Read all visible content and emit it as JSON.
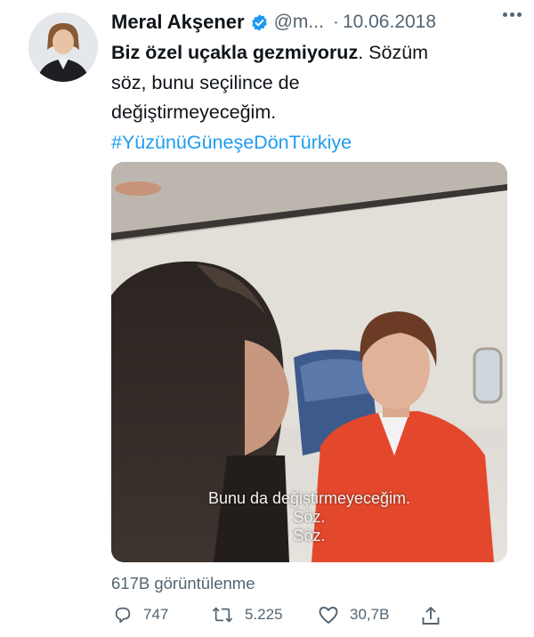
{
  "tweet": {
    "author_name": "Meral Akşener",
    "handle": "@m...",
    "separator": "·",
    "date": "10.06.2018",
    "text_bold": "Biz özel uçakla gezmiyoruz",
    "text_rest_1": ". Sözüm",
    "text_line_2": "söz, bunu seçilince de",
    "text_line_3": "değiştirmeyeceğim.",
    "hashtag": "#YüzünüGüneşeDönTürkiye",
    "subtitles": [
      "Bunu da değiştirmeyeceğim.",
      "Söz.",
      "Söz."
    ],
    "views": "617B görüntülenme",
    "actions": {
      "replies": "747",
      "retweets": "5.225",
      "likes": "30,7B"
    },
    "icons": [
      "verified-icon",
      "more-icon",
      "reply-icon",
      "retweet-icon",
      "like-icon",
      "share-icon"
    ],
    "colors": {
      "accent": "#1d9bf0",
      "text": "#0f1419",
      "secondary": "#536471",
      "jacket": "#e4482c"
    }
  }
}
